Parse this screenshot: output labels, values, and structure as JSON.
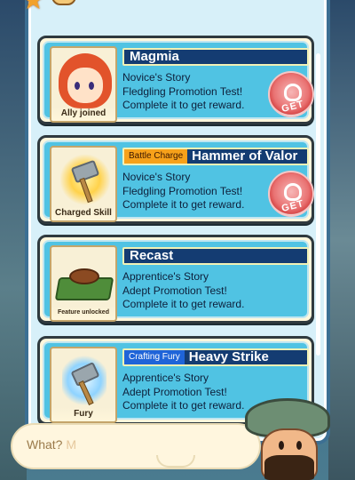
{
  "quests": [
    {
      "name": "Magmia",
      "tag": "",
      "tag_color": "",
      "caption": "Ally joined",
      "story": "Novice's Story",
      "test": "Fledgling Promotion Test!",
      "reward": "Complete it to get reward.",
      "button": "GET",
      "icon": "red-haired-girl-portrait"
    },
    {
      "name": "Hammer of Valor",
      "tag": "Battle Charge",
      "tag_color": "#f7a11a",
      "caption": "Charged Skill",
      "story": "Novice's Story",
      "test": "Fledgling Promotion Test!",
      "reward": "Complete it to get reward.",
      "button": "GET",
      "icon": "hammer-star-icon"
    },
    {
      "name": "Recast",
      "tag": "",
      "tag_color": "",
      "caption": "Feature unlocked",
      "story": "Apprentice's Story",
      "test": "Adept Promotion Test!",
      "reward": "Complete it to get reward.",
      "button": "",
      "icon": "anvil-forge-icon"
    },
    {
      "name": "Heavy Strike",
      "tag": "Crafting Fury",
      "tag_color": "#1f64d8",
      "caption": "Fury",
      "story": "Apprentice's Story",
      "test": "Adept Promotion Test!",
      "reward": "Complete it to get reward.",
      "button": "",
      "icon": "hammer-orb-icon"
    }
  ],
  "chat": {
    "prompt": "What?",
    "typed": "M"
  }
}
